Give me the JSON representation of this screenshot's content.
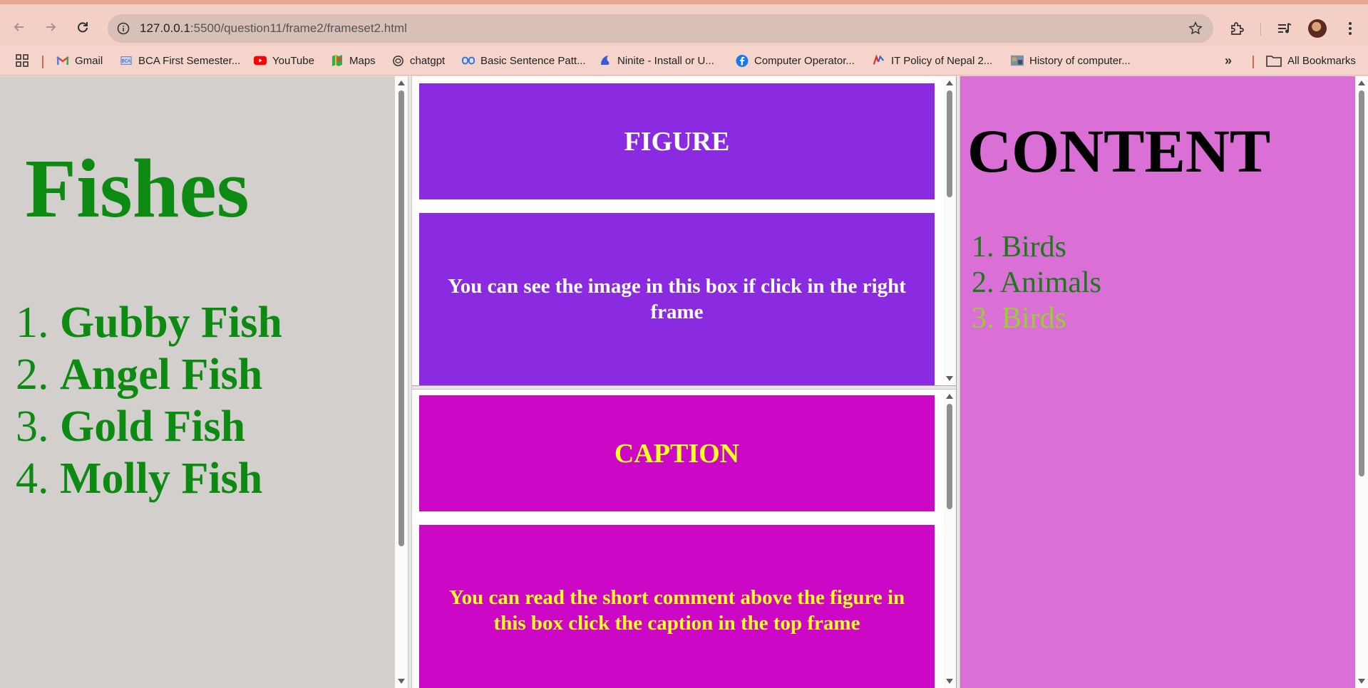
{
  "browser": {
    "url_host": "127.0.0.1",
    "url_rest": ":5500/question11/frame2/frameset2.html"
  },
  "bookmarks": [
    {
      "label": "Gmail",
      "icon": "gmail-icon"
    },
    {
      "label": "BCA First Semester...",
      "icon": "bca-icon"
    },
    {
      "label": "YouTube",
      "icon": "youtube-icon"
    },
    {
      "label": "Maps",
      "icon": "maps-icon"
    },
    {
      "label": "chatgpt",
      "icon": "chatgpt-icon"
    },
    {
      "label": "Basic Sentence Patt...",
      "icon": "link-icon"
    },
    {
      "label": "Ninite - Install or U...",
      "icon": "ninite-icon"
    },
    {
      "label": "Computer Operator...",
      "icon": "facebook-icon"
    },
    {
      "label": "IT Policy of Nepal 2...",
      "icon": "itpolicy-icon"
    },
    {
      "label": "History of computer...",
      "icon": "image-icon"
    }
  ],
  "all_bookmarks_label": "All Bookmarks",
  "left_frame": {
    "title": "Fishes",
    "items": [
      {
        "num": "1.",
        "text": "Gubby Fish"
      },
      {
        "num": "2.",
        "text": "Angel Fish"
      },
      {
        "num": "3.",
        "text": "Gold Fish"
      },
      {
        "num": "4.",
        "text": "Molly Fish"
      }
    ]
  },
  "figure_frame": {
    "heading": "FIGURE",
    "body": "You can see the image in this box if click in the right frame"
  },
  "caption_frame": {
    "heading": "CAPTION",
    "body": "You can read the short comment above the figure in this box click the caption in the top frame"
  },
  "right_frame": {
    "title": "CONTENT",
    "items": [
      {
        "num": "1.",
        "text": "Birds",
        "color": "#1a7a1a"
      },
      {
        "num": "2.",
        "text": "Animals",
        "color": "#1a7a1a"
      },
      {
        "num": "3.",
        "text": "Birds",
        "color": "#9acd32"
      }
    ]
  },
  "colors": {
    "left_bg": "#d3cfcd",
    "green_text": "#0c8a12",
    "figure_bg": "#8a2be2",
    "caption_bg": "#cc08c6",
    "caption_text": "#ffff24",
    "right_bg": "#da70d6"
  }
}
